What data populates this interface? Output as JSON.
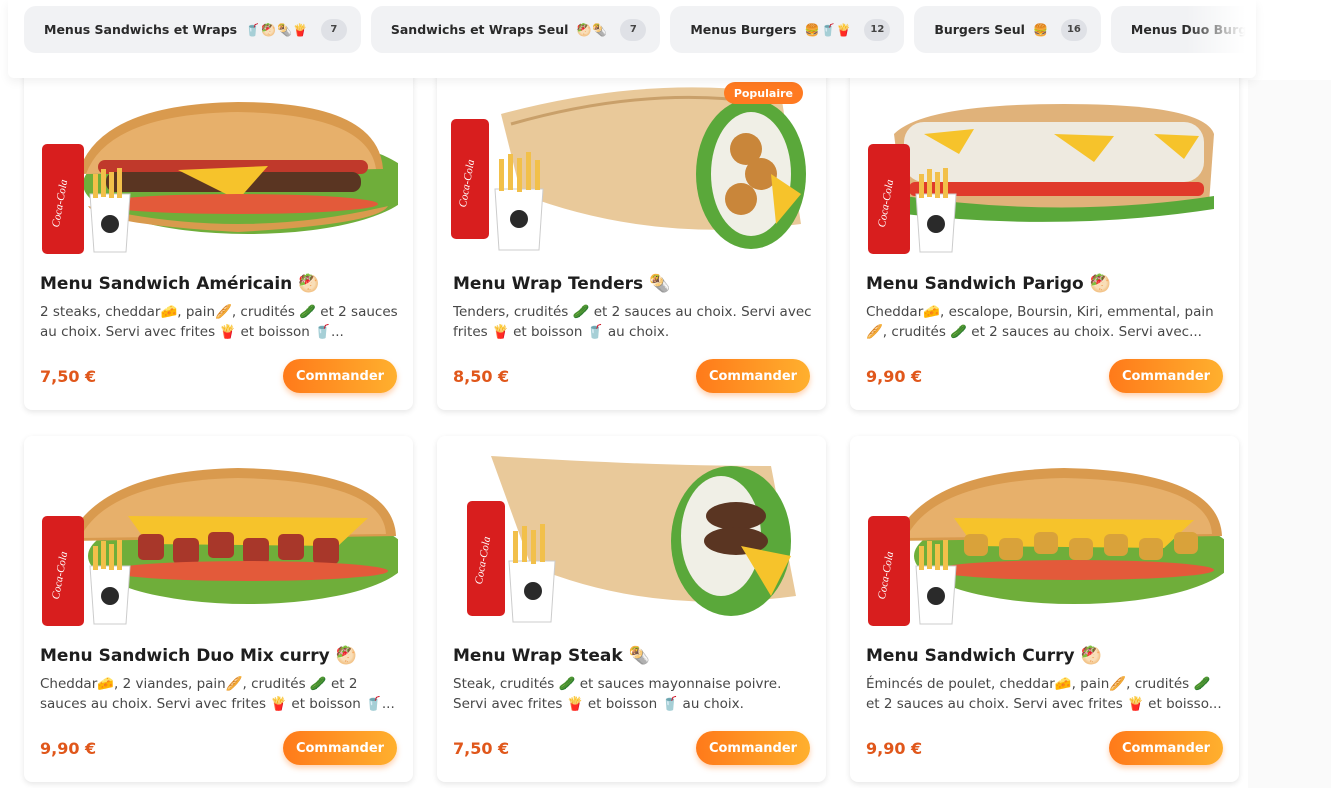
{
  "categories": [
    {
      "label": "Menus Sandwichs et Wraps",
      "emoji": "🥤🥙🌯🍟",
      "count": "7"
    },
    {
      "label": "Sandwichs et Wraps Seul",
      "emoji": "🥙🌯",
      "count": "7"
    },
    {
      "label": "Menus Burgers",
      "emoji": "🍔🥤🍟",
      "count": "12"
    },
    {
      "label": "Burgers Seul",
      "emoji": "🍔",
      "count": "16"
    },
    {
      "label": "Menus Duo Burgers",
      "emoji": "🥤🍔",
      "count": ""
    }
  ],
  "products": [
    {
      "title": "Menu Sandwich Américain 🥙",
      "desc": "2 steaks, cheddar🧀, pain🥖, crudités 🥒 et 2 sauces au choix. Servi avec frites 🍟 et boisson 🥤...",
      "price": "7,50 €",
      "button": "Commander",
      "badge": ""
    },
    {
      "title": "Menu Wrap Tenders 🌯",
      "desc": "Tenders, crudités 🥒 et 2 sauces au choix. Servi avec frites 🍟 et boisson 🥤 au choix.",
      "price": "8,50 €",
      "button": "Commander",
      "badge": "Populaire"
    },
    {
      "title": "Menu Sandwich Parigo 🥙",
      "desc": "Cheddar🧀, escalope, Boursin, Kiri, emmental, pain 🥖, crudités 🥒 et 2 sauces au choix. Servi avec...",
      "price": "9,90 €",
      "button": "Commander",
      "badge": ""
    },
    {
      "title": "Menu Sandwich Duo Mix curry 🥙",
      "desc": "Cheddar🧀, 2 viandes, pain🥖, crudités 🥒 et 2 sauces au choix. Servi avec frites 🍟 et boisson 🥤...",
      "price": "9,90 €",
      "button": "Commander",
      "badge": ""
    },
    {
      "title": "Menu Wrap Steak 🌯",
      "desc": "Steak, crudités 🥒 et sauces mayonnaise poivre. Servi avec frites 🍟 et boisson 🥤 au choix.",
      "price": "7,50 €",
      "button": "Commander",
      "badge": ""
    },
    {
      "title": "Menu Sandwich Curry 🥙",
      "desc": "Émincés de poulet, cheddar🧀, pain🥖, crudités 🥒 et 2 sauces au choix. Servi avec frites 🍟 et boisso...",
      "price": "9,90 €",
      "button": "Commander",
      "badge": ""
    }
  ],
  "can_text": "Coca-Cola",
  "colors": {
    "accent": "#ff7a1a",
    "accent_end": "#ffb02e",
    "price": "#e0571b",
    "can_red": "#d81e1e"
  }
}
